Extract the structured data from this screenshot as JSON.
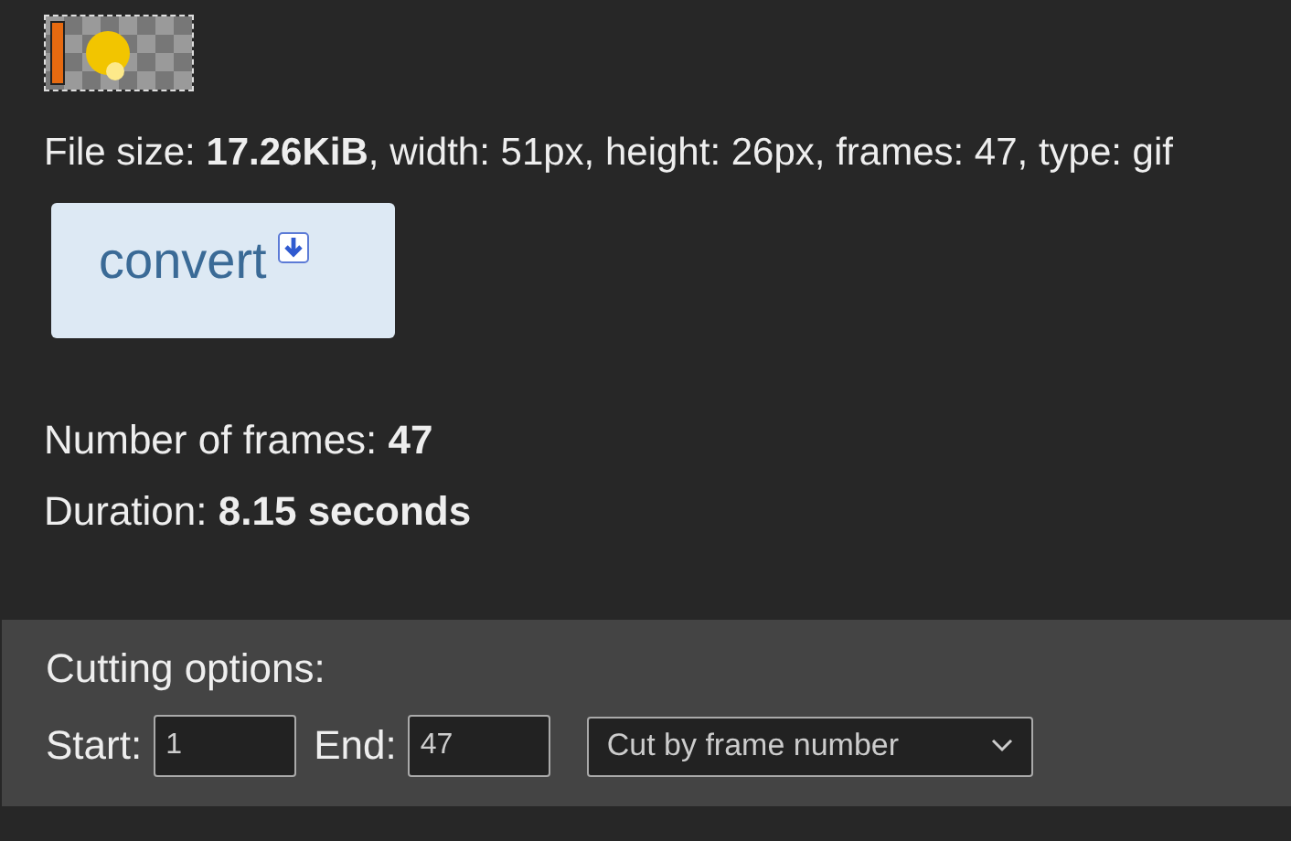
{
  "file_info": "File size: **17.26KiB**, width: 51px, height: 26px, frames: 47, type: gif",
  "convert_button": {
    "label": "convert"
  },
  "stats": [
    {
      "label": "Number of frames: ",
      "value": "47"
    },
    {
      "label": "Duration: ",
      "value": "8.15 seconds"
    }
  ],
  "cutting_options": {
    "title": "Cutting options:",
    "start": {
      "label": "Start:",
      "value": "1"
    },
    "end": {
      "label": "End:",
      "value": "47"
    },
    "mode": {
      "value": "Cut by frame number"
    }
  }
}
